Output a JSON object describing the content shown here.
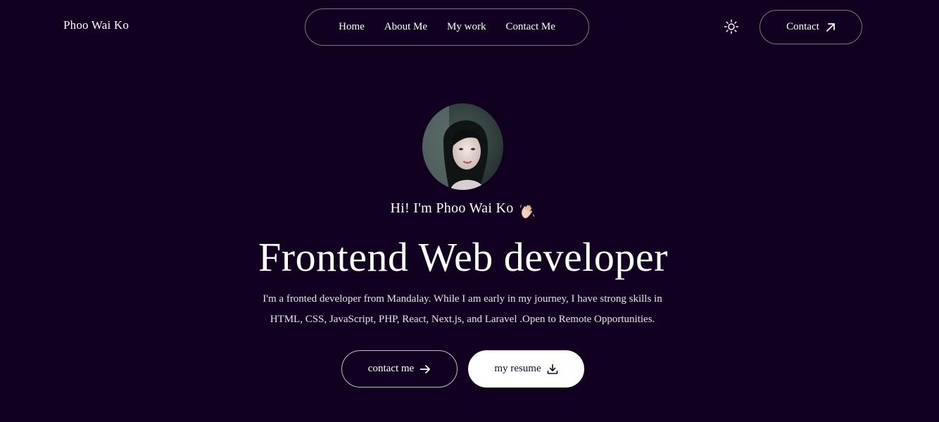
{
  "header": {
    "logo": "Phoo Wai Ko",
    "nav": [
      {
        "label": "Home"
      },
      {
        "label": "About Me"
      },
      {
        "label": "My work"
      },
      {
        "label": "Contact Me"
      }
    ],
    "theme_toggle_icon": "sun-icon",
    "contact_button": {
      "label": "Contact",
      "icon": "arrow-up-right-icon"
    }
  },
  "hero": {
    "greeting": "Hi! I'm Phoo Wai Ko",
    "greeting_icon": "waving-hand-icon",
    "title": "Frontend Web developer",
    "description_line1": "I'm a fronted developer from Mandalay. While I am early in my journey, I have strong skills in",
    "description_line2": "HTML, CSS, JavaScript, PHP, React, Next.js, and Laravel .Open to Remote Opportunities.",
    "primary_button": {
      "label": "contact me",
      "icon": "arrow-right-icon"
    },
    "secondary_button": {
      "label": "my resume",
      "icon": "download-icon"
    }
  },
  "colors": {
    "background": "#11001f",
    "text": "#ffffff",
    "solid_button_bg": "#ffffff",
    "solid_button_text": "#1a0a28"
  }
}
